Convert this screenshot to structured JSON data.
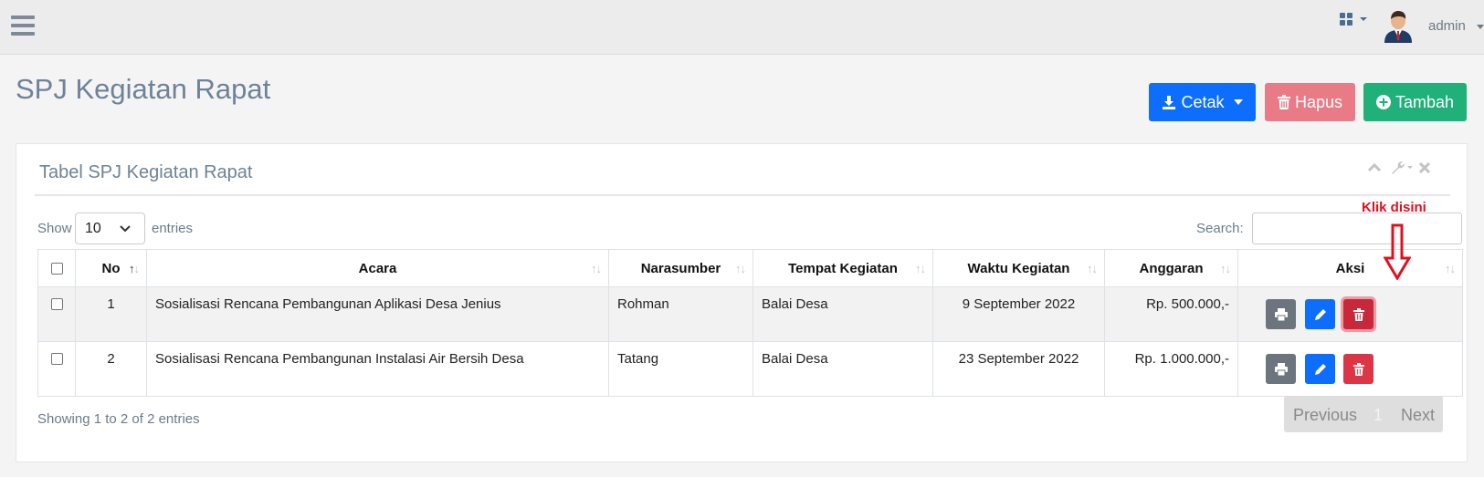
{
  "header": {
    "menu_icon": "hamburger-icon",
    "apps_icon": "grid-icon",
    "user": {
      "name": "admin",
      "avatar_icon": "user-avatar-icon"
    }
  },
  "page": {
    "title": "SPJ Kegiatan Rapat",
    "actions": {
      "print": {
        "label": "Cetak",
        "icon": "download-icon",
        "color": "#0d6efd"
      },
      "delete": {
        "label": "Hapus",
        "icon": "trash-icon",
        "color": "#e97b86"
      },
      "add": {
        "label": "Tambah",
        "icon": "plus-circle-icon",
        "color": "#20b07a"
      }
    }
  },
  "panel": {
    "title": "Tabel SPJ Kegiatan Rapat",
    "tools": [
      "chevron-up-icon",
      "wrench-icon",
      "close-icon"
    ]
  },
  "table_controls": {
    "show_label": "Show",
    "page_length": "10",
    "entries_label": "entries",
    "search_label": "Search:",
    "search_value": ""
  },
  "table": {
    "columns": [
      "No",
      "Acara",
      "Narasumber",
      "Tempat Kegiatan",
      "Waktu Kegiatan",
      "Anggaran",
      "Aksi"
    ],
    "rows": [
      {
        "no": "1",
        "acara": "Sosialisasi Rencana Pembangunan Aplikasi Desa Jenius",
        "narasumber": "Rohman",
        "tempat": "Balai Desa",
        "waktu": "9 September 2022",
        "anggaran": "Rp. 500.000,-"
      },
      {
        "no": "2",
        "acara": "Sosialisasi Rencana Pembangunan Instalasi Air Bersih Desa",
        "narasumber": "Tatang",
        "tempat": "Balai Desa",
        "waktu": "23 September 2022",
        "anggaran": "Rp. 1.000.000,-"
      }
    ]
  },
  "footer": {
    "info": "Showing 1 to 2 of 2 entries",
    "pagination": {
      "previous": "Previous",
      "current": "1",
      "next": "Next"
    }
  },
  "annotation": {
    "text": "Klik disini",
    "color": "#e0101e"
  }
}
